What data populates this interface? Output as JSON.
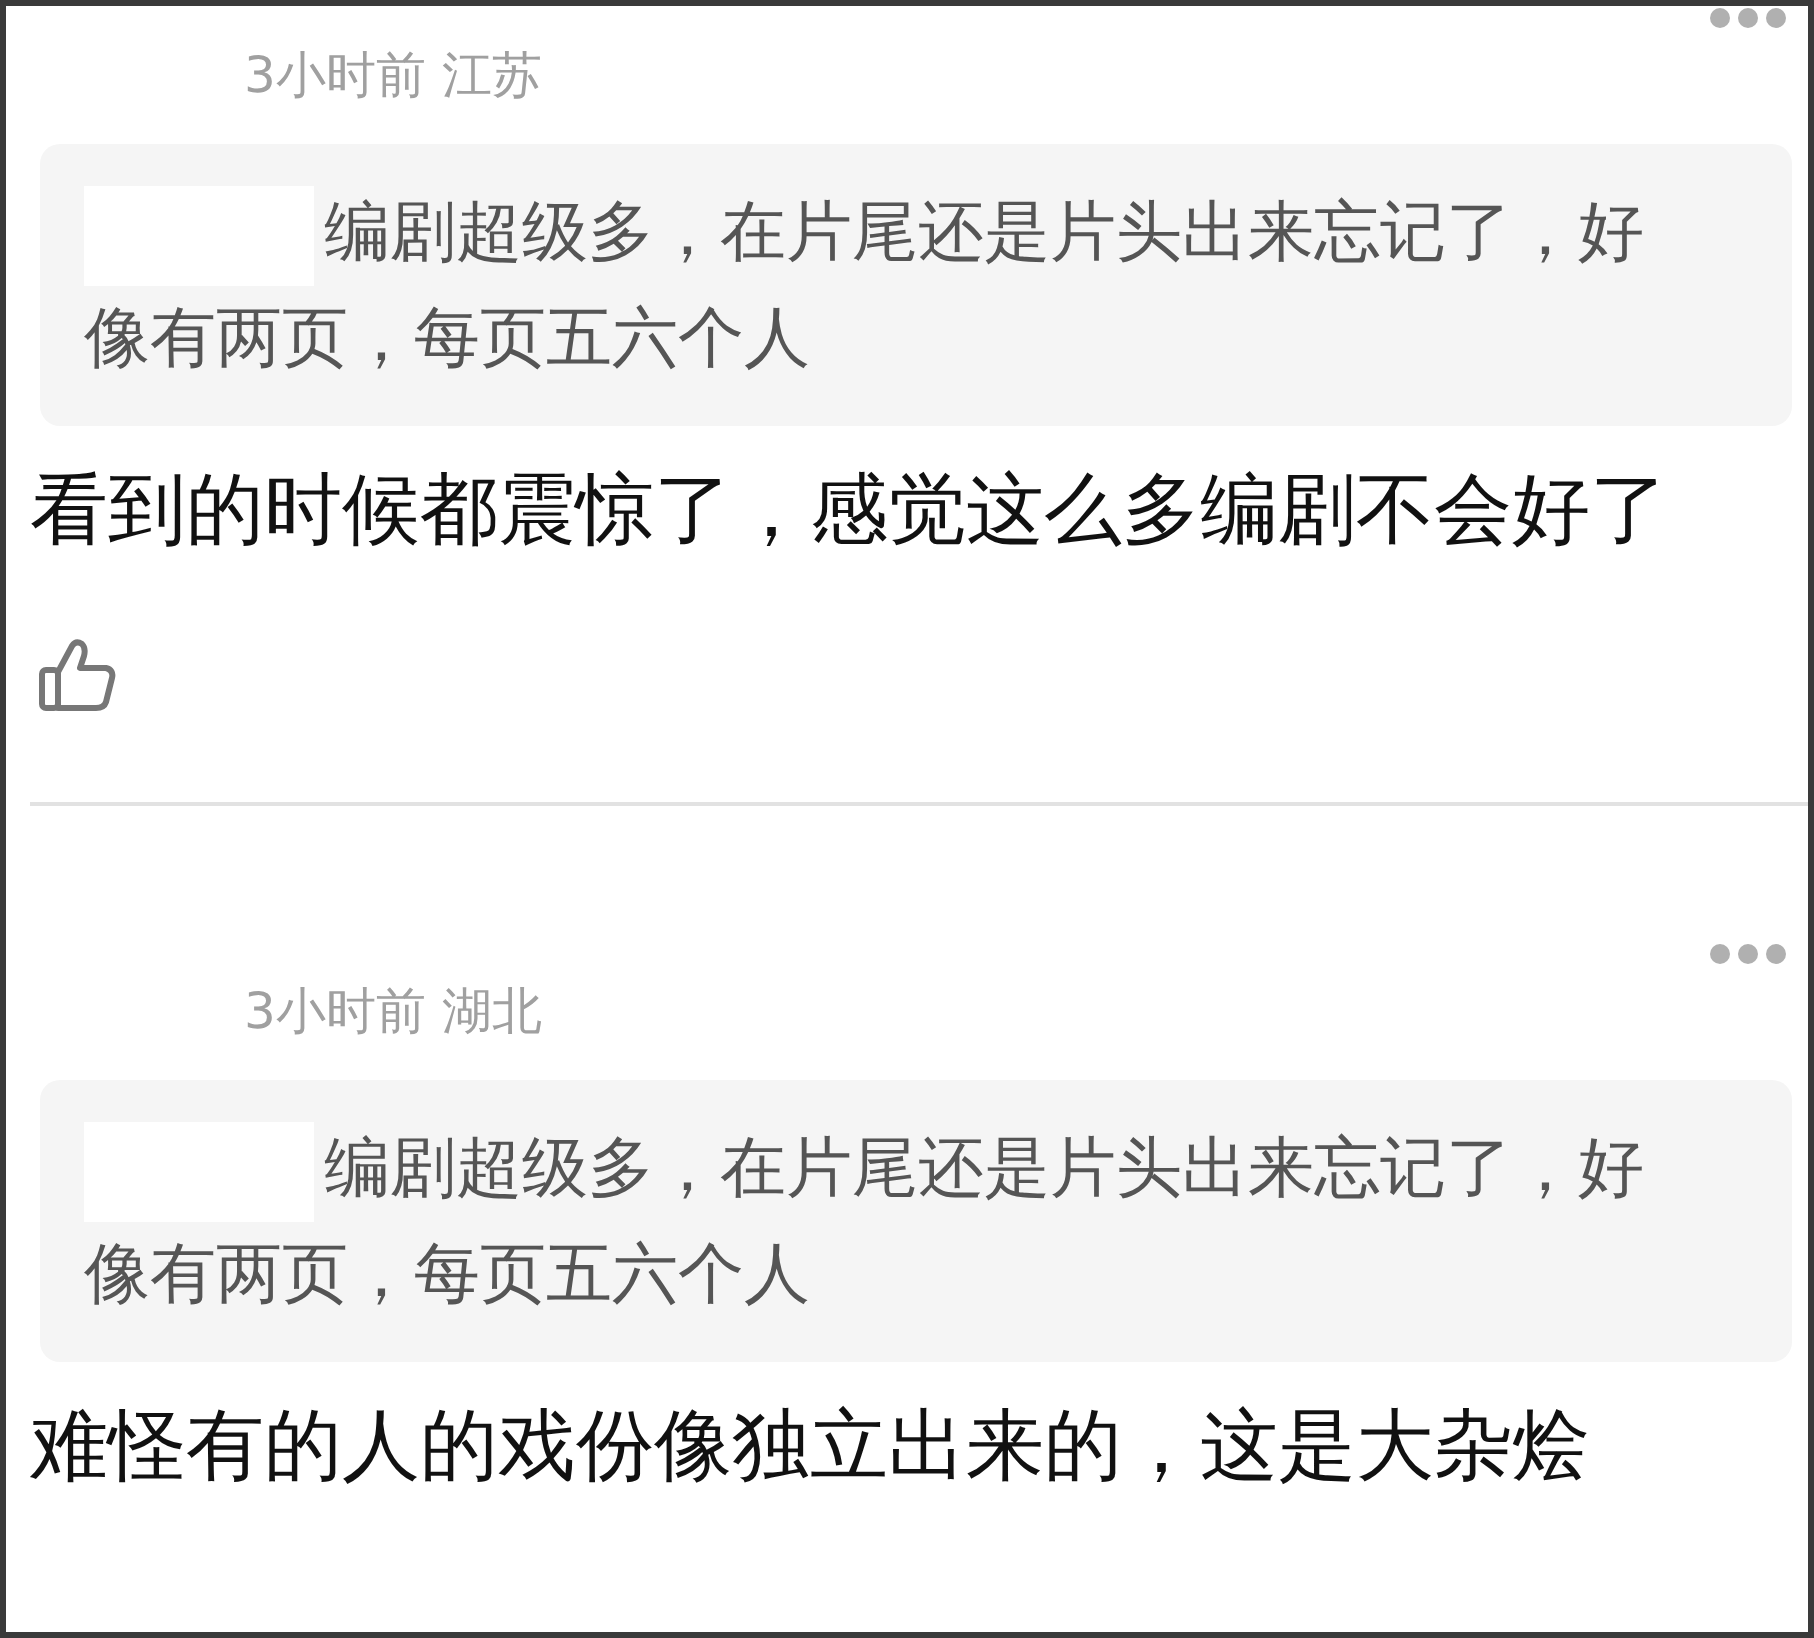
{
  "comments": [
    {
      "time": "3小时前",
      "location": "江苏",
      "quote": {
        "redacted_name": true,
        "text": "编剧超级多，在片尾还是片头出来忘记了，好像有两页，每页五六个人"
      },
      "text": "看到的时候都震惊了，感觉这么多编剧不会好了",
      "like_button": true
    },
    {
      "time": "3小时前",
      "location": "湖北",
      "quote": {
        "redacted_name": true,
        "text": "编剧超级多，在片尾还是片头出来忘记了，好像有两页，每页五六个人"
      },
      "text": "难怪有的人的戏份像独立出来的，这是大杂烩",
      "like_button": false
    }
  ]
}
